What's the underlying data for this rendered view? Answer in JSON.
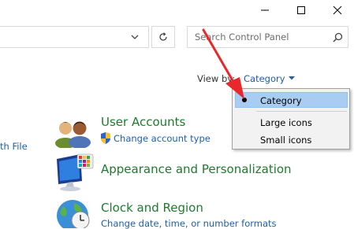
{
  "window": {
    "minimize_icon": "minimize-icon",
    "maximize_icon": "maximize-icon",
    "close_icon": "close-icon"
  },
  "address_bar": {
    "dropdown_icon": "chevron-down-icon",
    "refresh_icon": "refresh-icon"
  },
  "search": {
    "placeholder": "Search Control Panel",
    "icon": "search-icon"
  },
  "view_by": {
    "label": "View by:",
    "value": "Category"
  },
  "menu": {
    "items": [
      {
        "label": "Category",
        "selected": true
      },
      {
        "label": "Large icons",
        "selected": false
      },
      {
        "label": "Small icons",
        "selected": false
      }
    ]
  },
  "left_link": "th File",
  "categories": [
    {
      "title": "User Accounts",
      "links": [
        "Change account type"
      ],
      "icon": "users-icon",
      "link_icon": "shield-icon"
    },
    {
      "title": "Appearance and Personalization",
      "links": [],
      "icon": "monitor-palette-icon"
    },
    {
      "title": "Clock and Region",
      "links": [
        "Change date, time, or number formats"
      ],
      "icon": "globe-clock-icon"
    }
  ],
  "colors": {
    "category_title": "#1e7b2d",
    "link": "#1e5fa8",
    "menu_highlight": "#a9cdf2",
    "arrow": "#e8282b"
  }
}
